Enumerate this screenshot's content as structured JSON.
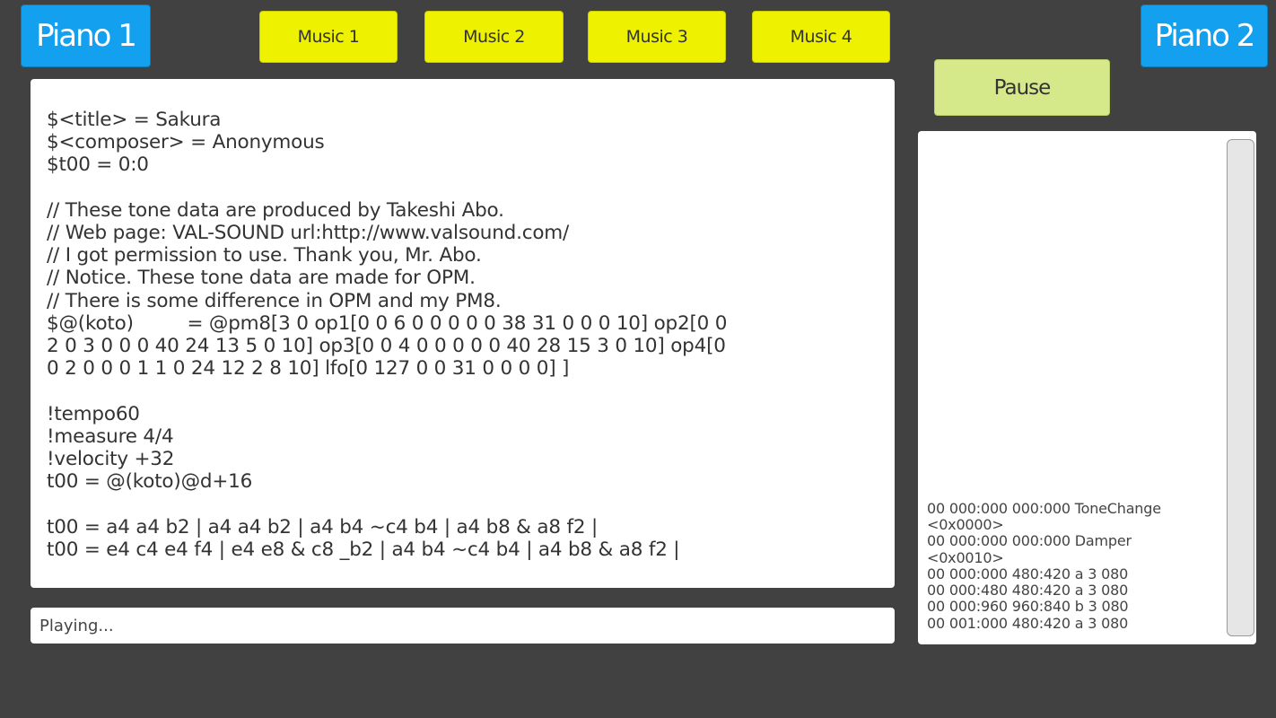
{
  "buttons": {
    "piano1": "Piano 1",
    "piano2": "Piano 2",
    "music": [
      "Music 1",
      "Music 2",
      "Music 3",
      "Music 4"
    ],
    "pause": "Pause"
  },
  "score_text": "$<title> = Sakura\n$<composer> = Anonymous\n$t00 = 0:0\n\n// These tone data are produced by Takeshi Abo.\n// Web page: VAL-SOUND url:http://www.valsound.com/\n// I got permission to use. Thank you, Mr. Abo.\n// Notice. These tone data are made for OPM.\n// There is some difference in OPM and my PM8.\n$@(koto)         = @pm8[3 0 op1[0 0 6 0 0 0 0 0 38 31 0 0 0 10] op2[0 0\n2 0 3 0 0 0 40 24 13 5 0 10] op3[0 0 4 0 0 0 0 0 40 28 15 3 0 10] op4[0\n0 2 0 0 0 1 1 0 24 12 2 8 10] lfo[0 127 0 0 31 0 0 0 0] ]\n\n!tempo60\n!measure 4/4\n!velocity +32\nt00 = @(koto)@d+16\n\nt00 = a4 a4 b2 | a4 a4 b2 | a4 b4 ~c4 b4 | a4 b8 & a8 f2 |\nt00 = e4 c4 e4 f4 | e4 e8 & c8 _b2 | a4 b4 ~c4 b4 | a4 b8 & a8 f2 |",
  "status_text": "Playing...",
  "log_text": "00 000:000 000:000 ToneChange\n<0x0000>\n00 000:000 000:000 Damper\n<0x0010>\n00 000:000 480:420 a 3 080\n00 000:480 480:420 a 3 080\n00 000:960 960:840 b 3 080\n00 001:000 480:420 a 3 080"
}
